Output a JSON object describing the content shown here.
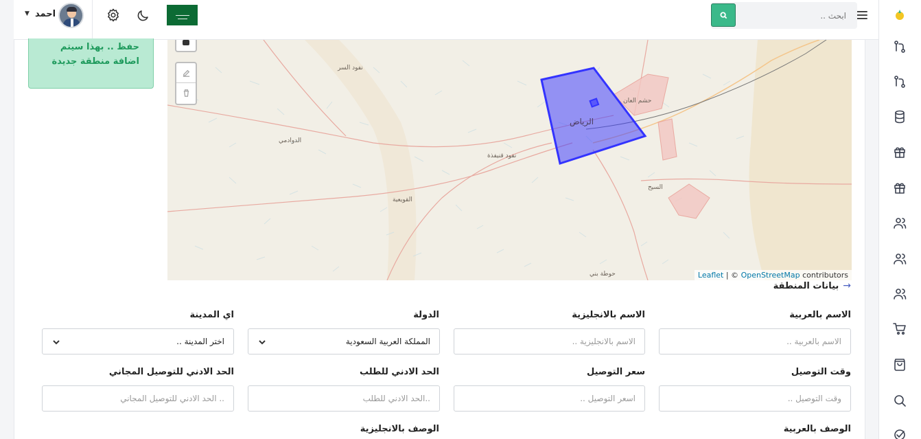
{
  "header": {
    "search_placeholder": "ابحث ..",
    "user_name": "احمد"
  },
  "notice": {
    "text": "حفظ .. بهذا سيتم اضافة منطقة جديدة"
  },
  "map": {
    "labels": {
      "riyadh": "الرياض",
      "hisham": "حشم العان",
      "nafud_sirr": "نفود السر",
      "dawadmi": "الدوادمي",
      "nafud_qunayfidhah": "نفود قنيفذة",
      "quwayiyah": "القويعية",
      "seih": "السيح",
      "hawtat_bani": "حوطة بني"
    },
    "attribution": {
      "leaflet": "Leaflet",
      "separator": "| ©",
      "osm": "OpenStreetMap",
      "contributors": "contributors"
    }
  },
  "section": {
    "title": "بيانات المنطقة",
    "arrow": "→"
  },
  "form": {
    "name_ar": {
      "label": "الاسم بالعربية",
      "placeholder": "الاسم بالعربية .."
    },
    "name_en": {
      "label": "الاسم بالانجليزية",
      "placeholder": "الاسم بالانجليزية .."
    },
    "country": {
      "label": "الدولة",
      "value": "المملكة العربية السعودية"
    },
    "city": {
      "label": "اي المدينة",
      "value": "اختر المدينة .."
    },
    "delivery_time": {
      "label": "وقت التوصيل",
      "placeholder": "وقت التوصيل .."
    },
    "delivery_price": {
      "label": "سعر التوصيل",
      "placeholder": "اسعر التوصيل .."
    },
    "min_order": {
      "label": "الحد الادني للطلب",
      "placeholder": "..الحد الادني للطلب"
    },
    "min_free_delivery": {
      "label": "الحد الادني للتوصيل المجاني",
      "placeholder": ".. الحد الادني للتوصيل المجاني"
    },
    "desc_ar": {
      "label": "الوصف بالعربية"
    },
    "desc_en": {
      "label": "الوصف بالانجليزية"
    }
  },
  "colors": {
    "accent_green": "#3bb98a",
    "notice_bg": "#b9ead3",
    "notice_text": "#1e9a5c",
    "polygon": "#3333ff"
  },
  "icons": [
    "logo-icon",
    "branch-icon",
    "branch-icon",
    "database-icon",
    "gift-icon",
    "gift-icon",
    "users-icon",
    "users-icon",
    "users-icon",
    "cart-icon",
    "bag-icon",
    "search-icon",
    "check-icon"
  ]
}
